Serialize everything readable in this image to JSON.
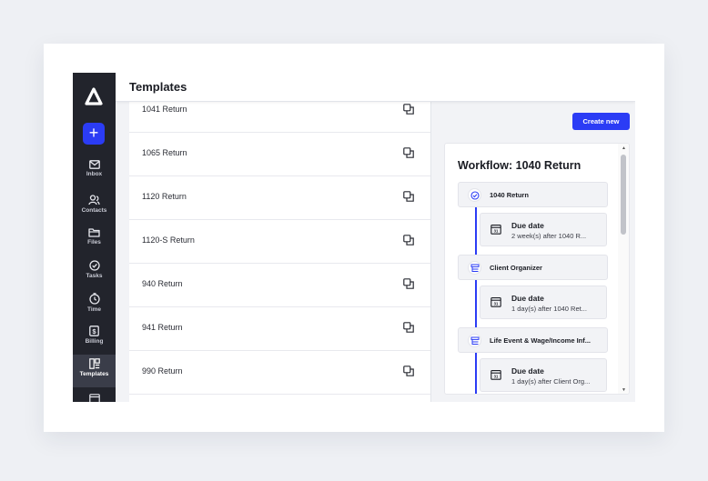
{
  "header": {
    "title": "Templates"
  },
  "sidebar": {
    "items": [
      {
        "label": "Inbox",
        "icon": "mail-icon"
      },
      {
        "label": "Contacts",
        "icon": "contacts-icon"
      },
      {
        "label": "Files",
        "icon": "folder-icon"
      },
      {
        "label": "Tasks",
        "icon": "check-circle-icon"
      },
      {
        "label": "Time",
        "icon": "timer-icon"
      },
      {
        "label": "Billing",
        "icon": "billing-icon"
      },
      {
        "label": "Templates",
        "icon": "templates-icon",
        "active": true
      }
    ],
    "plus_label": "+"
  },
  "templates": {
    "items": [
      "1041 Return",
      "1065 Return",
      "1120 Return",
      "1120-S Return",
      "940 Return",
      "941 Return",
      "990 Return"
    ]
  },
  "panel": {
    "create_label": "Create new",
    "workflow_title": "Workflow: 1040 Return",
    "steps": [
      {
        "label": "1040 Return",
        "due_title": "Due date",
        "due_sub": "2 week(s) after 1040 R..."
      },
      {
        "label": "Client Organizer",
        "due_title": "Due date",
        "due_sub": "1 day(s) after 1040 Ret..."
      },
      {
        "label": "Life Event & Wage/Income Inf...",
        "due_title": "Due date",
        "due_sub": "1 day(s) after Client Org..."
      }
    ]
  },
  "colors": {
    "accent": "#2b3cf5",
    "sidebar": "#22242c"
  }
}
